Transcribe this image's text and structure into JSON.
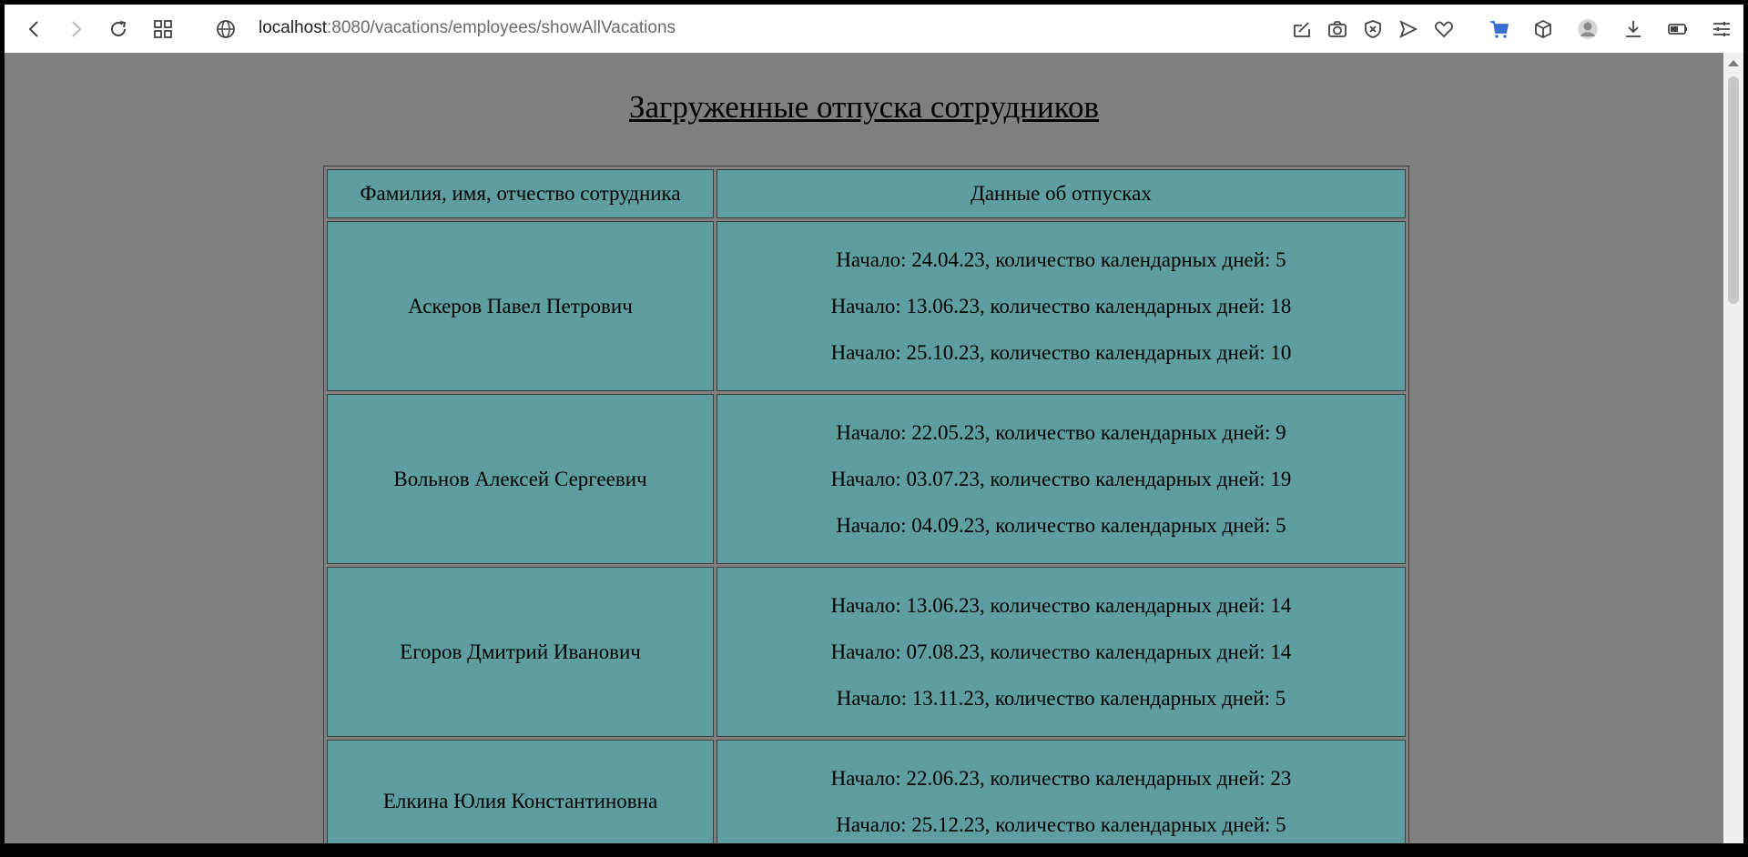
{
  "browser": {
    "url_host": "localhost",
    "url_rest": ":8080/vacations/employees/showAllVacations"
  },
  "page": {
    "title": "Загруженные отпуска сотрудников",
    "columns": [
      "Фамилия, имя, отчество сотрудника",
      "Данные об отпусках"
    ],
    "rows": [
      {
        "name": "Аскеров Павел Петрович",
        "vacations": [
          "Начало: 24.04.23, количество календарных дней: 5",
          "Начало: 13.06.23, количество календарных дней: 18",
          "Начало: 25.10.23, количество календарных дней: 10"
        ]
      },
      {
        "name": "Вольнов Алексей Сергеевич",
        "vacations": [
          "Начало: 22.05.23, количество календарных дней: 9",
          "Начало: 03.07.23, количество календарных дней: 19",
          "Начало: 04.09.23, количество календарных дней: 5"
        ]
      },
      {
        "name": "Егоров Дмитрий Иванович",
        "vacations": [
          "Начало: 13.06.23, количество календарных дней: 14",
          "Начало: 07.08.23, количество календарных дней: 14",
          "Начало: 13.11.23, количество календарных дней: 5"
        ]
      },
      {
        "name": "Елкина Юлия Константиновна",
        "vacations": [
          "Начало: 22.06.23, количество календарных дней: 23",
          "Начало: 25.12.23, количество календарных дней: 5"
        ]
      }
    ]
  },
  "icons": {
    "toolbar_left": [
      "back-icon",
      "forward-icon",
      "reload-icon",
      "tabs-grid-icon",
      "globe-icon"
    ],
    "toolbar_right": [
      "edit-icon",
      "camera-icon",
      "shield-icon",
      "send-icon",
      "heart-icon",
      "cart-icon",
      "cube-icon",
      "avatar-icon",
      "download-icon",
      "battery-icon",
      "menu-icon"
    ]
  },
  "colors": {
    "page_bg": "#808080",
    "cell_bg": "#5f9ea0",
    "cart_accent": "#3b6fd1"
  }
}
